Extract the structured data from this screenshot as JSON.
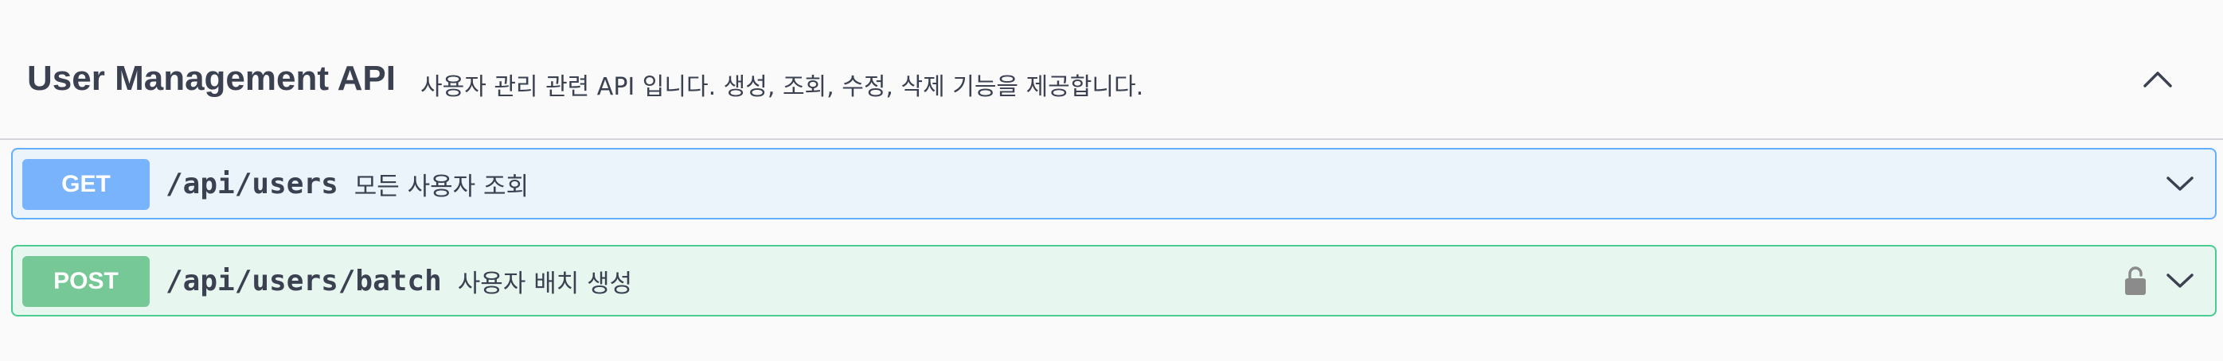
{
  "tag": {
    "title": "User Management API",
    "description": "사용자 관리 관련 API 입니다. 생성, 조회, 수정, 삭제 기능을 제공합니다."
  },
  "operations": [
    {
      "method": "GET",
      "path": "/api/users",
      "summary": "모든 사용자 조회",
      "color": "#61affe",
      "icons": [
        "chevron-down-icon"
      ]
    },
    {
      "method": "POST",
      "path": "/api/users/batch",
      "summary": "사용자 배치 생성",
      "color": "#49cc90",
      "icons": [
        "lock-icon",
        "chevron-down-icon"
      ]
    }
  ],
  "icons": {
    "collapse": "chevron-up-icon"
  }
}
